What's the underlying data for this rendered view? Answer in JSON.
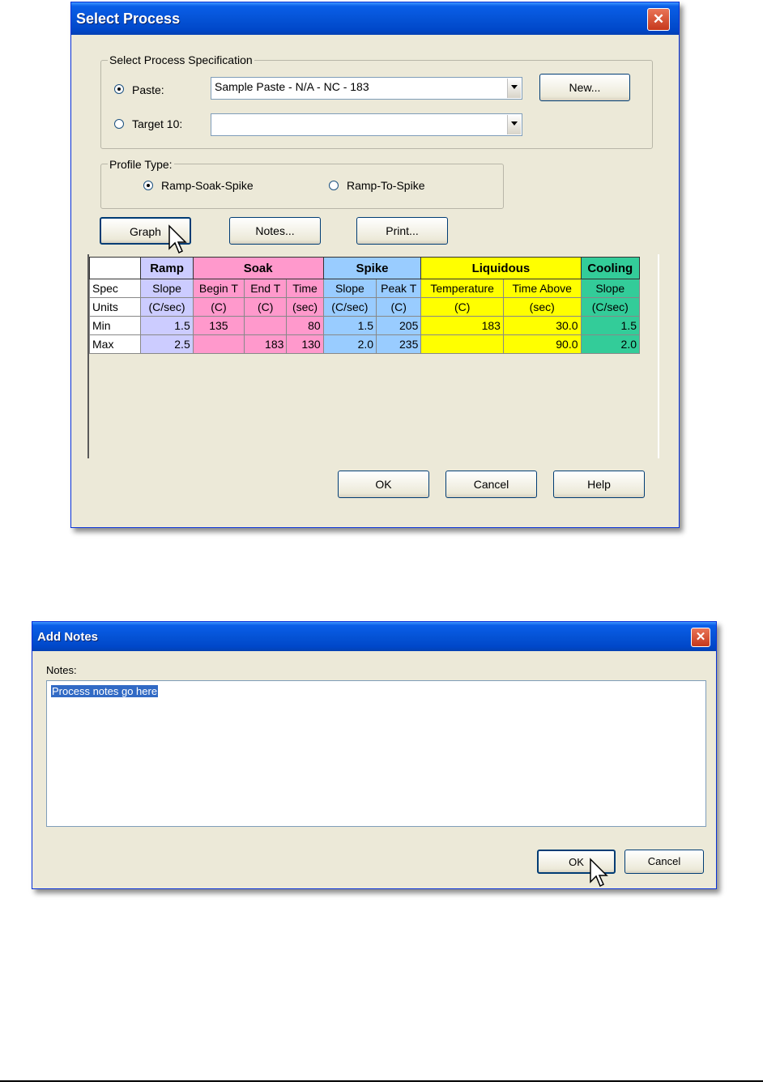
{
  "select_process": {
    "title": "Select Process",
    "close_glyph": "✕",
    "spec_group_label": "Select Process Specification",
    "paste_label": "Paste:",
    "paste_value": "Sample Paste - N/A - NC - 183",
    "target_label": "Target 10:",
    "target_value": "",
    "new_button": "New...",
    "profile_group_label": "Profile Type:",
    "profile_options": [
      "Ramp-Soak-Spike",
      "Ramp-To-Spike"
    ],
    "selected_profile": "Ramp-Soak-Spike",
    "graph_button": "Graph",
    "notes_button": "Notes...",
    "print_button": "Print...",
    "ok_button": "OK",
    "cancel_button": "Cancel",
    "help_button": "Help",
    "table": {
      "groups": [
        "Ramp",
        "Soak",
        "Spike",
        "Liquidous",
        "Cooling"
      ],
      "row_headers": [
        "Spec",
        "Units",
        "Min",
        "Max"
      ],
      "columns": [
        {
          "group": "Ramp",
          "spec": "Slope",
          "units": "(C/sec)",
          "min": "1.5",
          "max": "2.5"
        },
        {
          "group": "Soak",
          "spec": "Begin T",
          "units": "(C)",
          "min": "135",
          "max": ""
        },
        {
          "group": "Soak",
          "spec": "End T",
          "units": "(C)",
          "min": "",
          "max": "183"
        },
        {
          "group": "Soak",
          "spec": "Time",
          "units": "(sec)",
          "min": "80",
          "max": "130"
        },
        {
          "group": "Spike",
          "spec": "Slope",
          "units": "(C/sec)",
          "min": "1.5",
          "max": "2.0"
        },
        {
          "group": "Spike",
          "spec": "Peak T",
          "units": "(C)",
          "min": "205",
          "max": "235"
        },
        {
          "group": "Liquidous",
          "spec": "Temperature",
          "units": "(C)",
          "min": "183",
          "max": ""
        },
        {
          "group": "Liquidous",
          "spec": "Time Above",
          "units": "(sec)",
          "min": "30.0",
          "max": "90.0"
        },
        {
          "group": "Cooling",
          "spec": "Slope",
          "units": "(C/sec)",
          "min": "1.5",
          "max": "2.0"
        }
      ]
    },
    "colors": {
      "ramp": "#ccccff",
      "soak": "#ff99cc",
      "spike": "#99ccff",
      "liquidous": "#ffff00",
      "cooling": "#33cc99"
    }
  },
  "add_notes": {
    "title": "Add Notes",
    "close_glyph": "✕",
    "notes_label": "Notes:",
    "notes_text": "Process notes go here",
    "ok_button": "OK",
    "cancel_button": "Cancel"
  }
}
